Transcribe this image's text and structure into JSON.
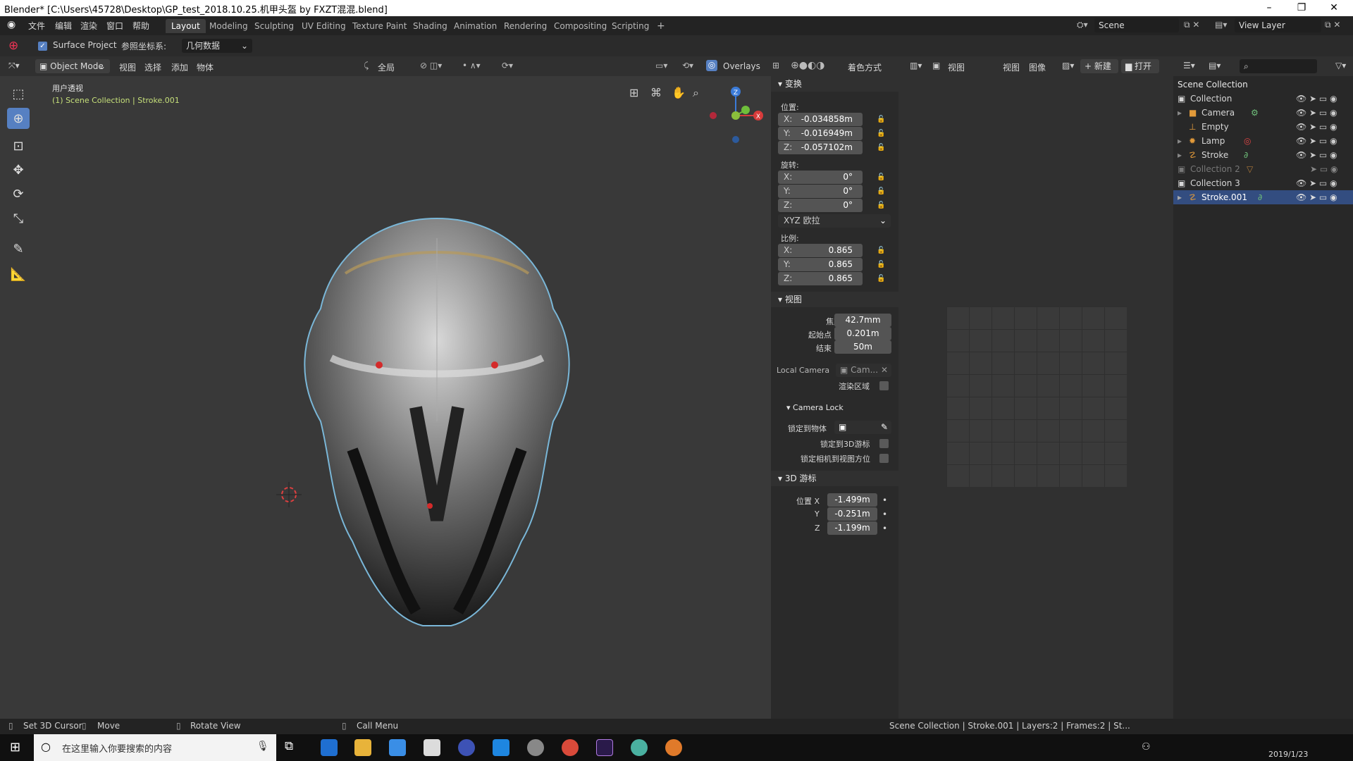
{
  "window": {
    "title": "Blender* [C:\\Users\\45728\\Desktop\\GP_test_2018.10.25.机甲头盔  by FXZT混混.blend]",
    "controls": [
      "–",
      "❐",
      "✕"
    ]
  },
  "menubar": {
    "items": [
      "文件",
      "编辑",
      "渲染",
      "窗口",
      "帮助"
    ],
    "workspaces": [
      "Layout",
      "Modeling",
      "Sculpting",
      "UV Editing",
      "Texture Paint",
      "Shading",
      "Animation",
      "Rendering",
      "Compositing",
      "Scripting"
    ],
    "active_workspace": "Layout",
    "add_tab": "+",
    "scene": "Scene",
    "view_layer": "View Layer"
  },
  "tool_settings": {
    "surface_project": "Surface Project",
    "ref_label": "参照坐标系:",
    "ref_value": "几何数据"
  },
  "viewport_header": {
    "mode": "Object Mode",
    "menus": [
      "视图",
      "选择",
      "添加",
      "物体"
    ],
    "orientation": "全局",
    "overlays": "Overlays",
    "shading": "着色方式"
  },
  "viewport": {
    "view_name": "用户透视",
    "collection_info": "(1) Scene Collection | Stroke.001",
    "gizmo": {
      "z": "Z",
      "x": "X"
    }
  },
  "npanel": {
    "transform": {
      "header": "变换",
      "location_label": "位置:",
      "location": [
        {
          "axis": "X:",
          "value": "-0.034858m"
        },
        {
          "axis": "Y:",
          "value": "-0.016949m"
        },
        {
          "axis": "Z:",
          "value": "-0.057102m"
        }
      ],
      "rotation_label": "旋转:",
      "rotation": [
        {
          "axis": "X:",
          "value": "0°"
        },
        {
          "axis": "Y:",
          "value": "0°"
        },
        {
          "axis": "Z:",
          "value": "0°"
        }
      ],
      "rotation_mode": "XYZ 欧拉",
      "scale_label": "比例:",
      "scale": [
        {
          "axis": "X:",
          "value": "0.865"
        },
        {
          "axis": "Y:",
          "value": "0.865"
        },
        {
          "axis": "Z:",
          "value": "0.865"
        }
      ]
    },
    "view": {
      "header": "视图",
      "focal_label": "焦距",
      "focal": "42.7mm",
      "clip_start_label": "起始点",
      "clip_start": "0.201m",
      "clip_end_label": "结束",
      "clip_end": "50m",
      "local_camera_label": "Local Camera",
      "local_camera": "Cam...",
      "render_region_label": "渲染区域",
      "camera_lock_header": "Camera Lock",
      "lock_object_label": "锁定到物体",
      "lock_cursor_label": "锁定到3D游标",
      "lock_camera_label": "锁定相机到视图方位"
    },
    "cursor": {
      "header": "3D 游标",
      "location_label": "位置 X",
      "x": "-1.499m",
      "y_label": "Y",
      "y": "-0.251m",
      "z_label": "Z",
      "z": "-1.199m"
    }
  },
  "image_editor": {
    "menus": [
      "视图",
      "视图",
      "图像"
    ],
    "new": "新建",
    "open": "打开"
  },
  "outliner": {
    "root": "Scene Collection",
    "rows": [
      {
        "name": "Collection",
        "level": 0
      },
      {
        "name": "Camera",
        "level": 1
      },
      {
        "name": "Empty",
        "level": 1
      },
      {
        "name": "Lamp",
        "level": 1
      },
      {
        "name": "Stroke",
        "level": 1
      },
      {
        "name": "Collection 2",
        "level": 0
      },
      {
        "name": "Collection 3",
        "level": 0
      },
      {
        "name": "Stroke.001",
        "level": 1
      }
    ]
  },
  "statusbar": {
    "items": [
      "Set 3D Cursor",
      "Move",
      "Rotate View",
      "Call Menu"
    ],
    "info": "Scene Collection | Stroke.001 | Layers:2 | Frames:2 | St..."
  },
  "taskbar": {
    "search_placeholder": "在这里输入你要搜索的内容",
    "date": "2019/1/23"
  },
  "colors": {
    "accent": "#5680c2",
    "selection": "#334d80",
    "viewport_bg": "#393939",
    "info_green": "#c6e07a"
  }
}
